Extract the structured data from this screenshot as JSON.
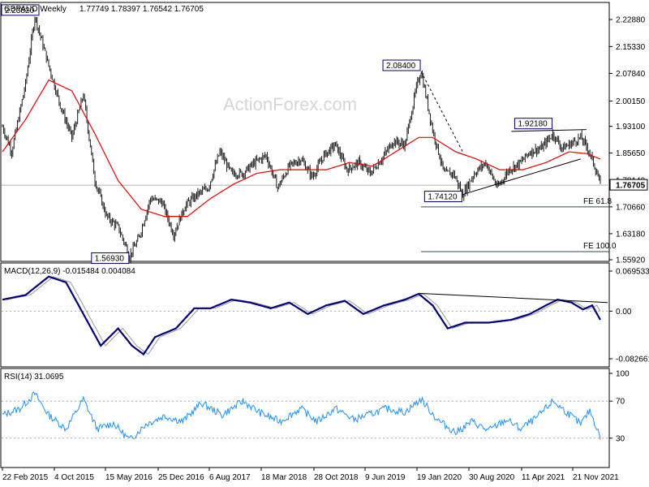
{
  "colors": {
    "bars": "#1a1a1a",
    "ma": "#e60000",
    "macd": "#00007a",
    "signal": "#999999",
    "rsi": "#1e90ff",
    "levelbox": "#00007a",
    "fe": "#2f4f4f",
    "grid_dash": "#aaaaaa"
  },
  "header": {
    "symbol": "GBPAUD,Weekly",
    "ohlc": "1.77749 1.78397 1.76542 1.76705"
  },
  "watermark": "ActionForex.com",
  "chart_data": [
    {
      "type": "ohlc",
      "title": "GBPAUD,Weekly 1.77749 1.78397 1.76542 1.76705",
      "x_ticks": [
        "22 Feb 2015",
        "4 Oct 2015",
        "15 May 2016",
        "25 Dec 2016",
        "6 Aug 2017",
        "18 Mar 2018",
        "28 Oct 2018",
        "9 Jun 2019",
        "19 Jan 2020",
        "30 Aug 2020",
        "11 Apr 2021",
        "21 Nov 2021"
      ],
      "y_ticks": [
        "2.22880",
        "2.15330",
        "2.07840",
        "2.00150",
        "1.93100",
        "1.85650",
        "1.78140",
        "1.70660",
        "1.63180",
        "1.55920"
      ],
      "ylim": [
        1.5592,
        2.2288
      ],
      "current_price": "1.76705",
      "anchors": [
        [
          0,
          1.93
        ],
        [
          8,
          1.86
        ],
        [
          20,
          2.05
        ],
        [
          28,
          2.238
        ],
        [
          40,
          2.1
        ],
        [
          50,
          1.99
        ],
        [
          60,
          1.9
        ],
        [
          70,
          2.02
        ],
        [
          80,
          1.78
        ],
        [
          90,
          1.68
        ],
        [
          100,
          1.65
        ],
        [
          110,
          1.57
        ],
        [
          118,
          1.62
        ],
        [
          128,
          1.73
        ],
        [
          138,
          1.72
        ],
        [
          148,
          1.63
        ],
        [
          158,
          1.71
        ],
        [
          168,
          1.74
        ],
        [
          178,
          1.76
        ],
        [
          188,
          1.86
        ],
        [
          198,
          1.8
        ],
        [
          208,
          1.8
        ],
        [
          218,
          1.83
        ],
        [
          228,
          1.85
        ],
        [
          238,
          1.76
        ],
        [
          248,
          1.82
        ],
        [
          258,
          1.84
        ],
        [
          268,
          1.79
        ],
        [
          278,
          1.85
        ],
        [
          288,
          1.88
        ],
        [
          298,
          1.81
        ],
        [
          308,
          1.83
        ],
        [
          318,
          1.8
        ],
        [
          328,
          1.84
        ],
        [
          338,
          1.89
        ],
        [
          348,
          1.88
        ],
        [
          358,
          2.04
        ],
        [
          362,
          2.084
        ],
        [
          372,
          1.92
        ],
        [
          382,
          1.8
        ],
        [
          390,
          1.8
        ],
        [
          398,
          1.74
        ],
        [
          408,
          1.8
        ],
        [
          418,
          1.83
        ],
        [
          428,
          1.76
        ],
        [
          438,
          1.81
        ],
        [
          448,
          1.83
        ],
        [
          456,
          1.86
        ],
        [
          466,
          1.87
        ],
        [
          476,
          1.91
        ],
        [
          484,
          1.87
        ],
        [
          490,
          1.88
        ],
        [
          500,
          1.9
        ],
        [
          506,
          1.87
        ],
        [
          512,
          1.82
        ],
        [
          517,
          1.77
        ]
      ],
      "ma_anchors": [
        [
          0,
          1.86
        ],
        [
          20,
          1.95
        ],
        [
          40,
          2.06
        ],
        [
          60,
          2.03
        ],
        [
          80,
          1.91
        ],
        [
          100,
          1.78
        ],
        [
          120,
          1.7
        ],
        [
          140,
          1.68
        ],
        [
          160,
          1.68
        ],
        [
          180,
          1.73
        ],
        [
          200,
          1.77
        ],
        [
          220,
          1.8
        ],
        [
          240,
          1.81
        ],
        [
          260,
          1.81
        ],
        [
          280,
          1.81
        ],
        [
          300,
          1.83
        ],
        [
          320,
          1.82
        ],
        [
          340,
          1.86
        ],
        [
          360,
          1.9
        ],
        [
          372,
          1.9
        ],
        [
          392,
          1.86
        ],
        [
          410,
          1.84
        ],
        [
          430,
          1.81
        ],
        [
          450,
          1.81
        ],
        [
          470,
          1.83
        ],
        [
          490,
          1.86
        ],
        [
          505,
          1.855
        ],
        [
          517,
          1.84
        ]
      ],
      "levels": [
        {
          "label": "2.23820",
          "value": 2.2382,
          "bar": 28
        },
        {
          "label": "2.08400",
          "value": 2.084,
          "bar": 362
        },
        {
          "label": "1.56930",
          "value": 1.5693,
          "bar": 110
        },
        {
          "label": "1.74120",
          "value": 1.7412,
          "bar": 398
        },
        {
          "label": "1.92180",
          "value": 1.9218,
          "bar": 476
        }
      ],
      "fib": [
        {
          "label": "FE 61.8",
          "value": 1.7066
        },
        {
          "label": "FE 100.0",
          "value": 1.5818
        }
      ]
    },
    {
      "type": "line",
      "title": "MACD(12,26,9) -0.015484 0.004084",
      "y_ticks": [
        "0.069533",
        "0.00",
        "-0.082661"
      ],
      "ylim": [
        -0.082661,
        0.069533
      ],
      "anchors": [
        [
          0,
          0.02
        ],
        [
          20,
          0.028
        ],
        [
          40,
          0.06
        ],
        [
          55,
          0.05
        ],
        [
          70,
          -0.005
        ],
        [
          85,
          -0.06
        ],
        [
          100,
          -0.03
        ],
        [
          112,
          -0.06
        ],
        [
          122,
          -0.075
        ],
        [
          132,
          -0.045
        ],
        [
          150,
          -0.03
        ],
        [
          166,
          0.005
        ],
        [
          180,
          0.005
        ],
        [
          198,
          0.02
        ],
        [
          214,
          0.015
        ],
        [
          232,
          0.005
        ],
        [
          248,
          0.015
        ],
        [
          264,
          -0.005
        ],
        [
          280,
          0.01
        ],
        [
          296,
          0.018
        ],
        [
          312,
          -0.005
        ],
        [
          330,
          0.01
        ],
        [
          348,
          0.02
        ],
        [
          360,
          0.03
        ],
        [
          372,
          0.01
        ],
        [
          385,
          -0.03
        ],
        [
          400,
          -0.02
        ],
        [
          420,
          -0.02
        ],
        [
          440,
          -0.015
        ],
        [
          456,
          -0.005
        ],
        [
          470,
          0.01
        ],
        [
          480,
          0.02
        ],
        [
          492,
          0.015
        ],
        [
          502,
          0.003
        ],
        [
          510,
          0.01
        ],
        [
          517,
          -0.015
        ]
      ]
    },
    {
      "type": "line",
      "title": "RSI(14) 31.0695",
      "y_ticks": [
        "100",
        "70",
        "30"
      ],
      "ylim": [
        0,
        100
      ],
      "anchors": [
        [
          0,
          55
        ],
        [
          15,
          62
        ],
        [
          28,
          78
        ],
        [
          40,
          55
        ],
        [
          55,
          40
        ],
        [
          70,
          72
        ],
        [
          82,
          40
        ],
        [
          96,
          46
        ],
        [
          110,
          28
        ],
        [
          124,
          45
        ],
        [
          140,
          54
        ],
        [
          156,
          48
        ],
        [
          172,
          68
        ],
        [
          190,
          55
        ],
        [
          208,
          70
        ],
        [
          222,
          58
        ],
        [
          240,
          48
        ],
        [
          258,
          62
        ],
        [
          272,
          48
        ],
        [
          288,
          62
        ],
        [
          304,
          50
        ],
        [
          318,
          56
        ],
        [
          332,
          62
        ],
        [
          348,
          58
        ],
        [
          362,
          72
        ],
        [
          376,
          50
        ],
        [
          392,
          36
        ],
        [
          406,
          48
        ],
        [
          420,
          38
        ],
        [
          436,
          50
        ],
        [
          448,
          40
        ],
        [
          462,
          52
        ],
        [
          476,
          70
        ],
        [
          490,
          56
        ],
        [
          500,
          45
        ],
        [
          508,
          60
        ],
        [
          517,
          31
        ]
      ]
    }
  ]
}
